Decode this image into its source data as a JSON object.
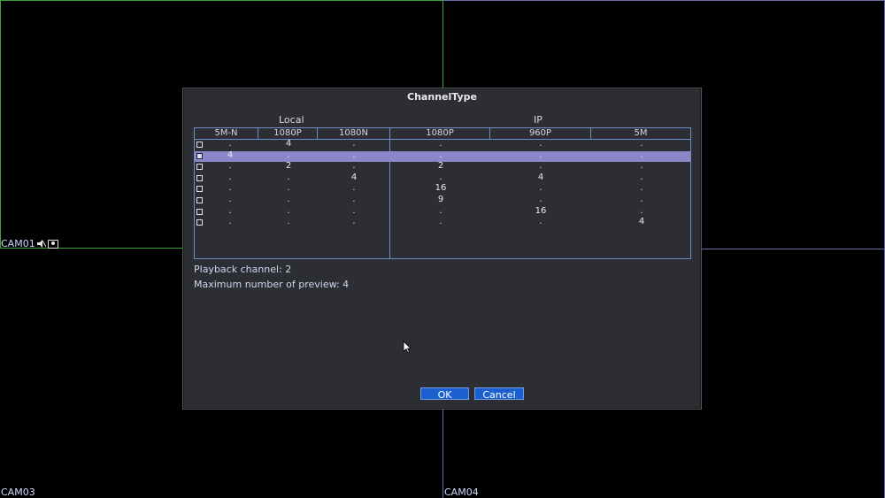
{
  "cameras": {
    "cam1": "CAM01",
    "cam3": "CAM03",
    "cam4": "CAM04"
  },
  "dialog": {
    "title": "ChannelType",
    "group_local": "Local",
    "group_ip": "IP",
    "columns": [
      "5M-N",
      "1080P",
      "1080N",
      "1080P",
      "960P",
      "5M"
    ],
    "rows": [
      {
        "checked": false,
        "selected": false,
        "cells": [
          ".",
          "4",
          ".",
          ".",
          ".",
          "."
        ]
      },
      {
        "checked": true,
        "selected": true,
        "cells": [
          "4",
          ".",
          ".",
          ".",
          ".",
          "."
        ]
      },
      {
        "checked": false,
        "selected": false,
        "cells": [
          ".",
          "2",
          ".",
          "2",
          ".",
          "."
        ]
      },
      {
        "checked": false,
        "selected": false,
        "cells": [
          ".",
          ".",
          "4",
          ".",
          "4",
          "."
        ]
      },
      {
        "checked": false,
        "selected": false,
        "cells": [
          ".",
          ".",
          ".",
          "16",
          ".",
          "."
        ]
      },
      {
        "checked": false,
        "selected": false,
        "cells": [
          ".",
          ".",
          ".",
          "9",
          ".",
          "."
        ]
      },
      {
        "checked": false,
        "selected": false,
        "cells": [
          ".",
          ".",
          ".",
          ".",
          "16",
          "."
        ]
      },
      {
        "checked": false,
        "selected": false,
        "cells": [
          ".",
          ".",
          ".",
          ".",
          ".",
          "4"
        ]
      }
    ],
    "playback_channel": "Playback channel: 2",
    "max_preview": "Maximum number of preview: 4",
    "ok_label": "OK",
    "cancel_label": "Cancel"
  },
  "colors": {
    "accent_button": "#1c5fd1",
    "selected_row": "#8b86c9",
    "table_border": "#6c8ec9"
  }
}
